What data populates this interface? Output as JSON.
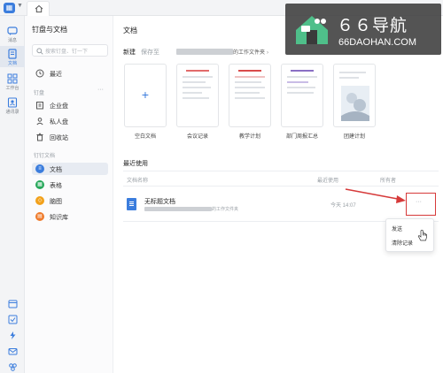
{
  "rail": {
    "items": [
      {
        "label": "消息",
        "icon": "chat-icon"
      },
      {
        "label": "文档",
        "icon": "document-icon"
      },
      {
        "label": "工作台",
        "icon": "grid-icon"
      },
      {
        "label": "通讯录",
        "icon": "contacts-icon"
      }
    ]
  },
  "sidebar": {
    "title": "钉盘与文档",
    "search_placeholder": "搜索钉盘、钉一下",
    "recent": "最近",
    "group_drive": "钉盘",
    "drive_items": [
      "企业盘",
      "私人盘",
      "回收站"
    ],
    "group_docs": "钉钉文档",
    "doc_items": [
      "文档",
      "表格",
      "脑图",
      "知识库"
    ],
    "dots": "···"
  },
  "main": {
    "title": "文档",
    "new_label": "新建",
    "new_hint": "保存至",
    "new_tail": "的工作文件夹",
    "templates": [
      {
        "name": "空白文档"
      },
      {
        "name": "会议记录"
      },
      {
        "name": "教学计划"
      },
      {
        "name": "部门周报汇总"
      },
      {
        "name": "团建计划"
      }
    ],
    "recent_title": "最近使用",
    "columns": {
      "name": "文档名称",
      "time": "最近使用",
      "owner": "所有者"
    },
    "row": {
      "name": "无标题文档",
      "path": "的工作文件夹",
      "time": "今天 14:07",
      "more": "···"
    }
  },
  "context_menu": {
    "items": [
      "发送",
      "清除记录"
    ]
  },
  "watermark": {
    "title": "６６导航",
    "url": "66DAOHAN.COM"
  },
  "colors": {
    "accent": "#3b7ddd",
    "highlight": "#d63a3a"
  }
}
